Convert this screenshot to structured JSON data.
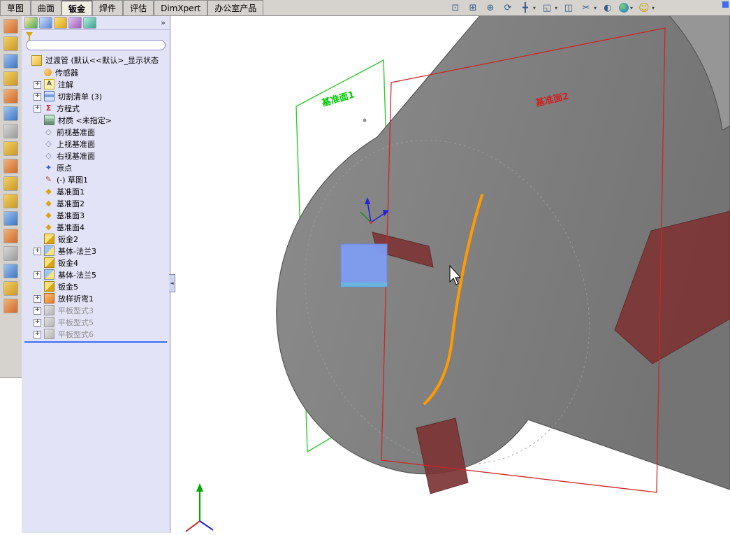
{
  "command_tabs": {
    "items": [
      {
        "label": "草图",
        "active": false
      },
      {
        "label": "曲面",
        "active": false
      },
      {
        "label": "钣金",
        "active": true
      },
      {
        "label": "焊件",
        "active": false
      },
      {
        "label": "评估",
        "active": false
      },
      {
        "label": "DimXpert",
        "active": false
      },
      {
        "label": "办公室产品",
        "active": false
      }
    ]
  },
  "view_toolbar": {
    "icons": [
      {
        "name": "zoom-to-fit-icon",
        "glyph": "⊡"
      },
      {
        "name": "zoom-area-icon",
        "glyph": "⊞"
      },
      {
        "name": "zoom-in-out-icon",
        "glyph": "⊕"
      },
      {
        "name": "rotate-view-icon",
        "glyph": "⟳"
      },
      {
        "name": "pan-icon",
        "glyph": "╋"
      },
      {
        "name": "standard-views-icon",
        "glyph": "◱"
      },
      {
        "name": "display-style-icon",
        "glyph": "◫"
      },
      {
        "name": "section-view-icon",
        "glyph": "✂"
      },
      {
        "name": "view-settings-icon",
        "glyph": "◐"
      },
      {
        "name": "appearance-globe-icon",
        "glyph": ""
      },
      {
        "name": "help-smiley-icon",
        "glyph": "☺"
      }
    ]
  },
  "left_toolbar": {
    "icons": [
      "left-tool-icon-1",
      "left-tool-icon-2",
      "left-tool-icon-3",
      "left-tool-icon-4",
      "left-tool-icon-5",
      "left-tool-icon-6",
      "left-tool-icon-7",
      "left-tool-icon-8",
      "left-tool-icon-9",
      "left-tool-icon-10",
      "left-tool-icon-11",
      "left-tool-icon-12",
      "left-tool-icon-13",
      "left-tool-icon-14",
      "left-tool-icon-15",
      "left-tool-icon-16",
      "left-tool-icon-17"
    ]
  },
  "feature_tree": {
    "manager_tabs": [
      "featuremanager-tab-icon",
      "propertymanager-tab-icon",
      "configurationmanager-tab-icon",
      "dimxpertmanager-tab-icon",
      "displaypane-tab-icon"
    ],
    "collapse_glyph": "»",
    "filter_value": "",
    "root_label": "过渡管 (默认<<默认>_显示状态",
    "items": [
      {
        "label": "传感器",
        "icon": "sensors-icon",
        "plus": false,
        "gray": false
      },
      {
        "label": "注解",
        "icon": "annotations-icon",
        "plus": true,
        "gray": false
      },
      {
        "label": "切割清单 (3)",
        "icon": "cut-list-icon",
        "plus": true,
        "gray": false
      },
      {
        "label": "方程式",
        "icon": "equations-icon",
        "plus": true,
        "gray": false
      },
      {
        "label": "材质 <未指定>",
        "icon": "material-icon",
        "plus": false,
        "gray": false
      },
      {
        "label": "前视基准面",
        "icon": "reference-plane-icon",
        "plus": false,
        "gray": false
      },
      {
        "label": "上视基准面",
        "icon": "reference-plane-icon",
        "plus": false,
        "gray": false
      },
      {
        "label": "右视基准面",
        "icon": "reference-plane-icon",
        "plus": false,
        "gray": false
      },
      {
        "label": "原点",
        "icon": "origin-icon",
        "plus": false,
        "gray": false
      },
      {
        "label": "(-) 草图1",
        "icon": "sketch-icon",
        "plus": false,
        "gray": false
      },
      {
        "label": "基准面1",
        "icon": "plane-icon",
        "plus": false,
        "gray": false
      },
      {
        "label": "基准面2",
        "icon": "plane-icon",
        "plus": false,
        "gray": false
      },
      {
        "label": "基准面3",
        "icon": "plane-icon",
        "plus": false,
        "gray": false
      },
      {
        "label": "基准面4",
        "icon": "plane-icon",
        "plus": false,
        "gray": false
      },
      {
        "label": "钣金2",
        "icon": "sheet-metal-icon",
        "plus": false,
        "gray": false
      },
      {
        "label": "基体-法兰3",
        "icon": "base-flange-icon",
        "plus": true,
        "gray": false
      },
      {
        "label": "钣金4",
        "icon": "sheet-metal-icon",
        "plus": false,
        "gray": false
      },
      {
        "label": "基体-法兰5",
        "icon": "base-flange-icon",
        "plus": true,
        "gray": false
      },
      {
        "label": "钣金5",
        "icon": "sheet-metal-icon",
        "plus": false,
        "gray": false
      },
      {
        "label": "放样折弯1",
        "icon": "lofted-bend-icon",
        "plus": true,
        "gray": false
      },
      {
        "label": "平板型式3",
        "icon": "flat-pattern-icon",
        "plus": true,
        "gray": true
      },
      {
        "label": "平板型式5",
        "icon": "flat-pattern-icon",
        "plus": true,
        "gray": true
      },
      {
        "label": "平板型式6",
        "icon": "flat-pattern-icon",
        "plus": true,
        "gray": true
      }
    ]
  },
  "viewport": {
    "plane1_label": "基准面1",
    "plane2_label": "基准面2",
    "colors": {
      "model": "#7f7f7f",
      "plane1_outline": "#2ecc2e",
      "plane2_outline": "#cc2626",
      "highlight_face": "#7f9df2",
      "spline_curve": "#ff9b00",
      "cut_patch": "#7d3535"
    }
  }
}
